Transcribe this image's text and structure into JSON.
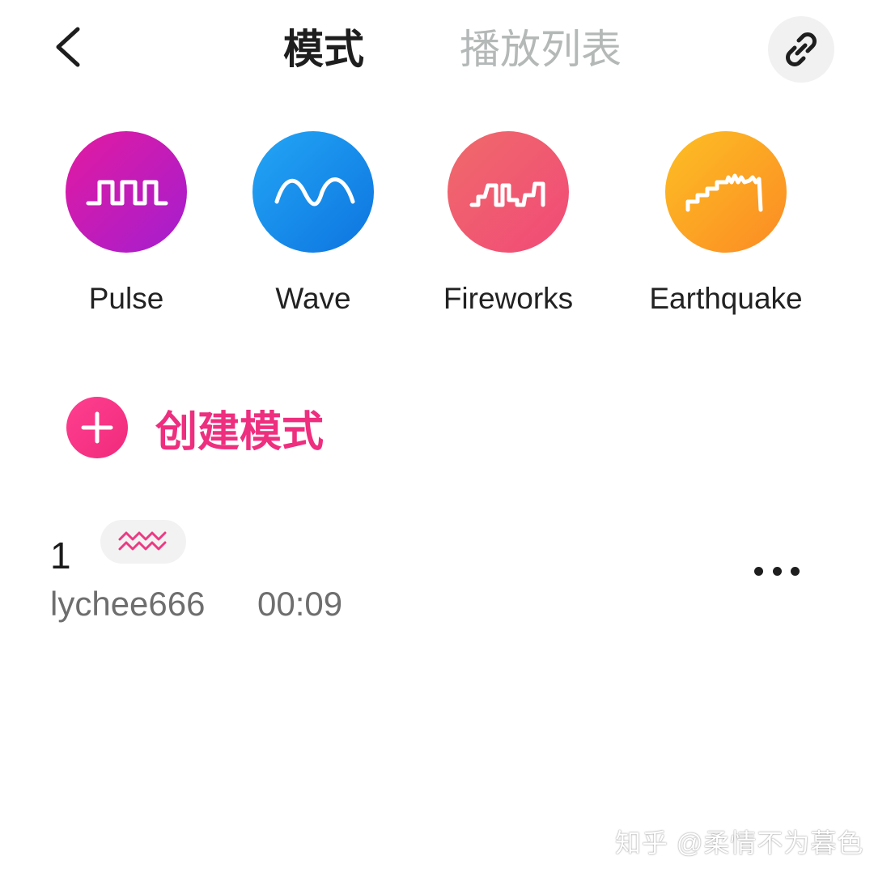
{
  "header": {
    "tabs": [
      {
        "label": "模式",
        "active": true
      },
      {
        "label": "播放列表",
        "active": false
      }
    ],
    "back_icon": "chevron-left-icon",
    "link_icon": "link-icon"
  },
  "modes": [
    {
      "label": "Pulse",
      "icon": "pulse-wave-icon",
      "color_start": "#e31aa0",
      "color_end": "#a31ed0"
    },
    {
      "label": "Wave",
      "icon": "sine-wave-icon",
      "color_start": "#23a6f5",
      "color_end": "#0d74e0"
    },
    {
      "label": "Fireworks",
      "icon": "fireworks-wave-icon",
      "color_start": "#f06a6a",
      "color_end": "#f14a78"
    },
    {
      "label": "Earthquake",
      "icon": "staircase-wave-icon",
      "color_start": "#fdbf24",
      "color_end": "#fb8a24"
    }
  ],
  "create": {
    "label": "创建模式",
    "icon": "plus-icon",
    "accent": "#ee2e7e"
  },
  "patterns": [
    {
      "title": "1",
      "badge_icon": "zigzag-wave-icon",
      "author": "lychee666",
      "duration": "00:09",
      "more_icon": "more-horizontal-icon"
    }
  ],
  "watermark": "知乎 @柔情不为暮色"
}
